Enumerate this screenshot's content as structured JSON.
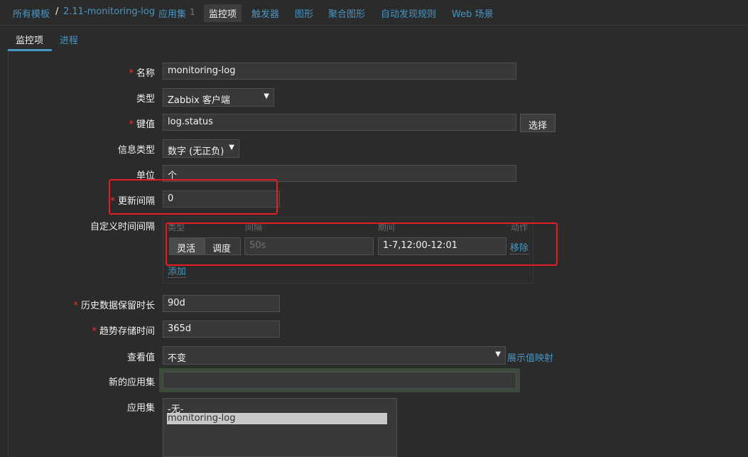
{
  "nav": {
    "all_templates": "所有模板",
    "separator": "/",
    "template_name": "2.11-monitoring-log",
    "applications": "应用集",
    "applications_count": "1",
    "items": "监控项",
    "triggers": "触发器",
    "graphs": "图形",
    "screens": "聚合图形",
    "discovery": "自动发现规则",
    "web": "Web 场景"
  },
  "tabs": {
    "item": "监控项",
    "preprocessing": "进程"
  },
  "form": {
    "name_label": "名称",
    "name_value": "monitoring-log",
    "type_label": "类型",
    "type_value": "Zabbix 客户端",
    "key_label": "键值",
    "key_value": "log.status",
    "key_select": "选择",
    "info_type_label": "信息类型",
    "info_type_value": "数字 (无正负)",
    "units_label": "单位",
    "units_value": "个",
    "interval_label": "更新间隔",
    "interval_value": "0",
    "custom_intervals_label": "自定义时间间隔",
    "custom": {
      "col_type": "类型",
      "col_interval": "间隔",
      "col_period": "期间",
      "col_action": "动作",
      "flexible": "灵活",
      "scheduling": "调度",
      "interval_placeholder": "50s",
      "period_value": "1-7,12:00-12:01",
      "remove": "移除",
      "add": "添加"
    },
    "history_label": "历史数据保留时长",
    "history_value": "90d",
    "trends_label": "趋势存储时间",
    "trends_value": "365d",
    "valuemap_label": "查看值",
    "valuemap_value": "不变",
    "valuemap_link": "展示值映射",
    "new_app_label": "新的应用集",
    "new_app_value": "",
    "apps_label": "应用集",
    "apps_options": [
      "-无-",
      "monitoring-log"
    ]
  },
  "required_mark": "*",
  "dropdown_arrow": "▼",
  "colors": {
    "accent": "#4796c4",
    "required": "#e33734",
    "highlight_box": "#e51c23",
    "background": "#2b2b2b"
  }
}
